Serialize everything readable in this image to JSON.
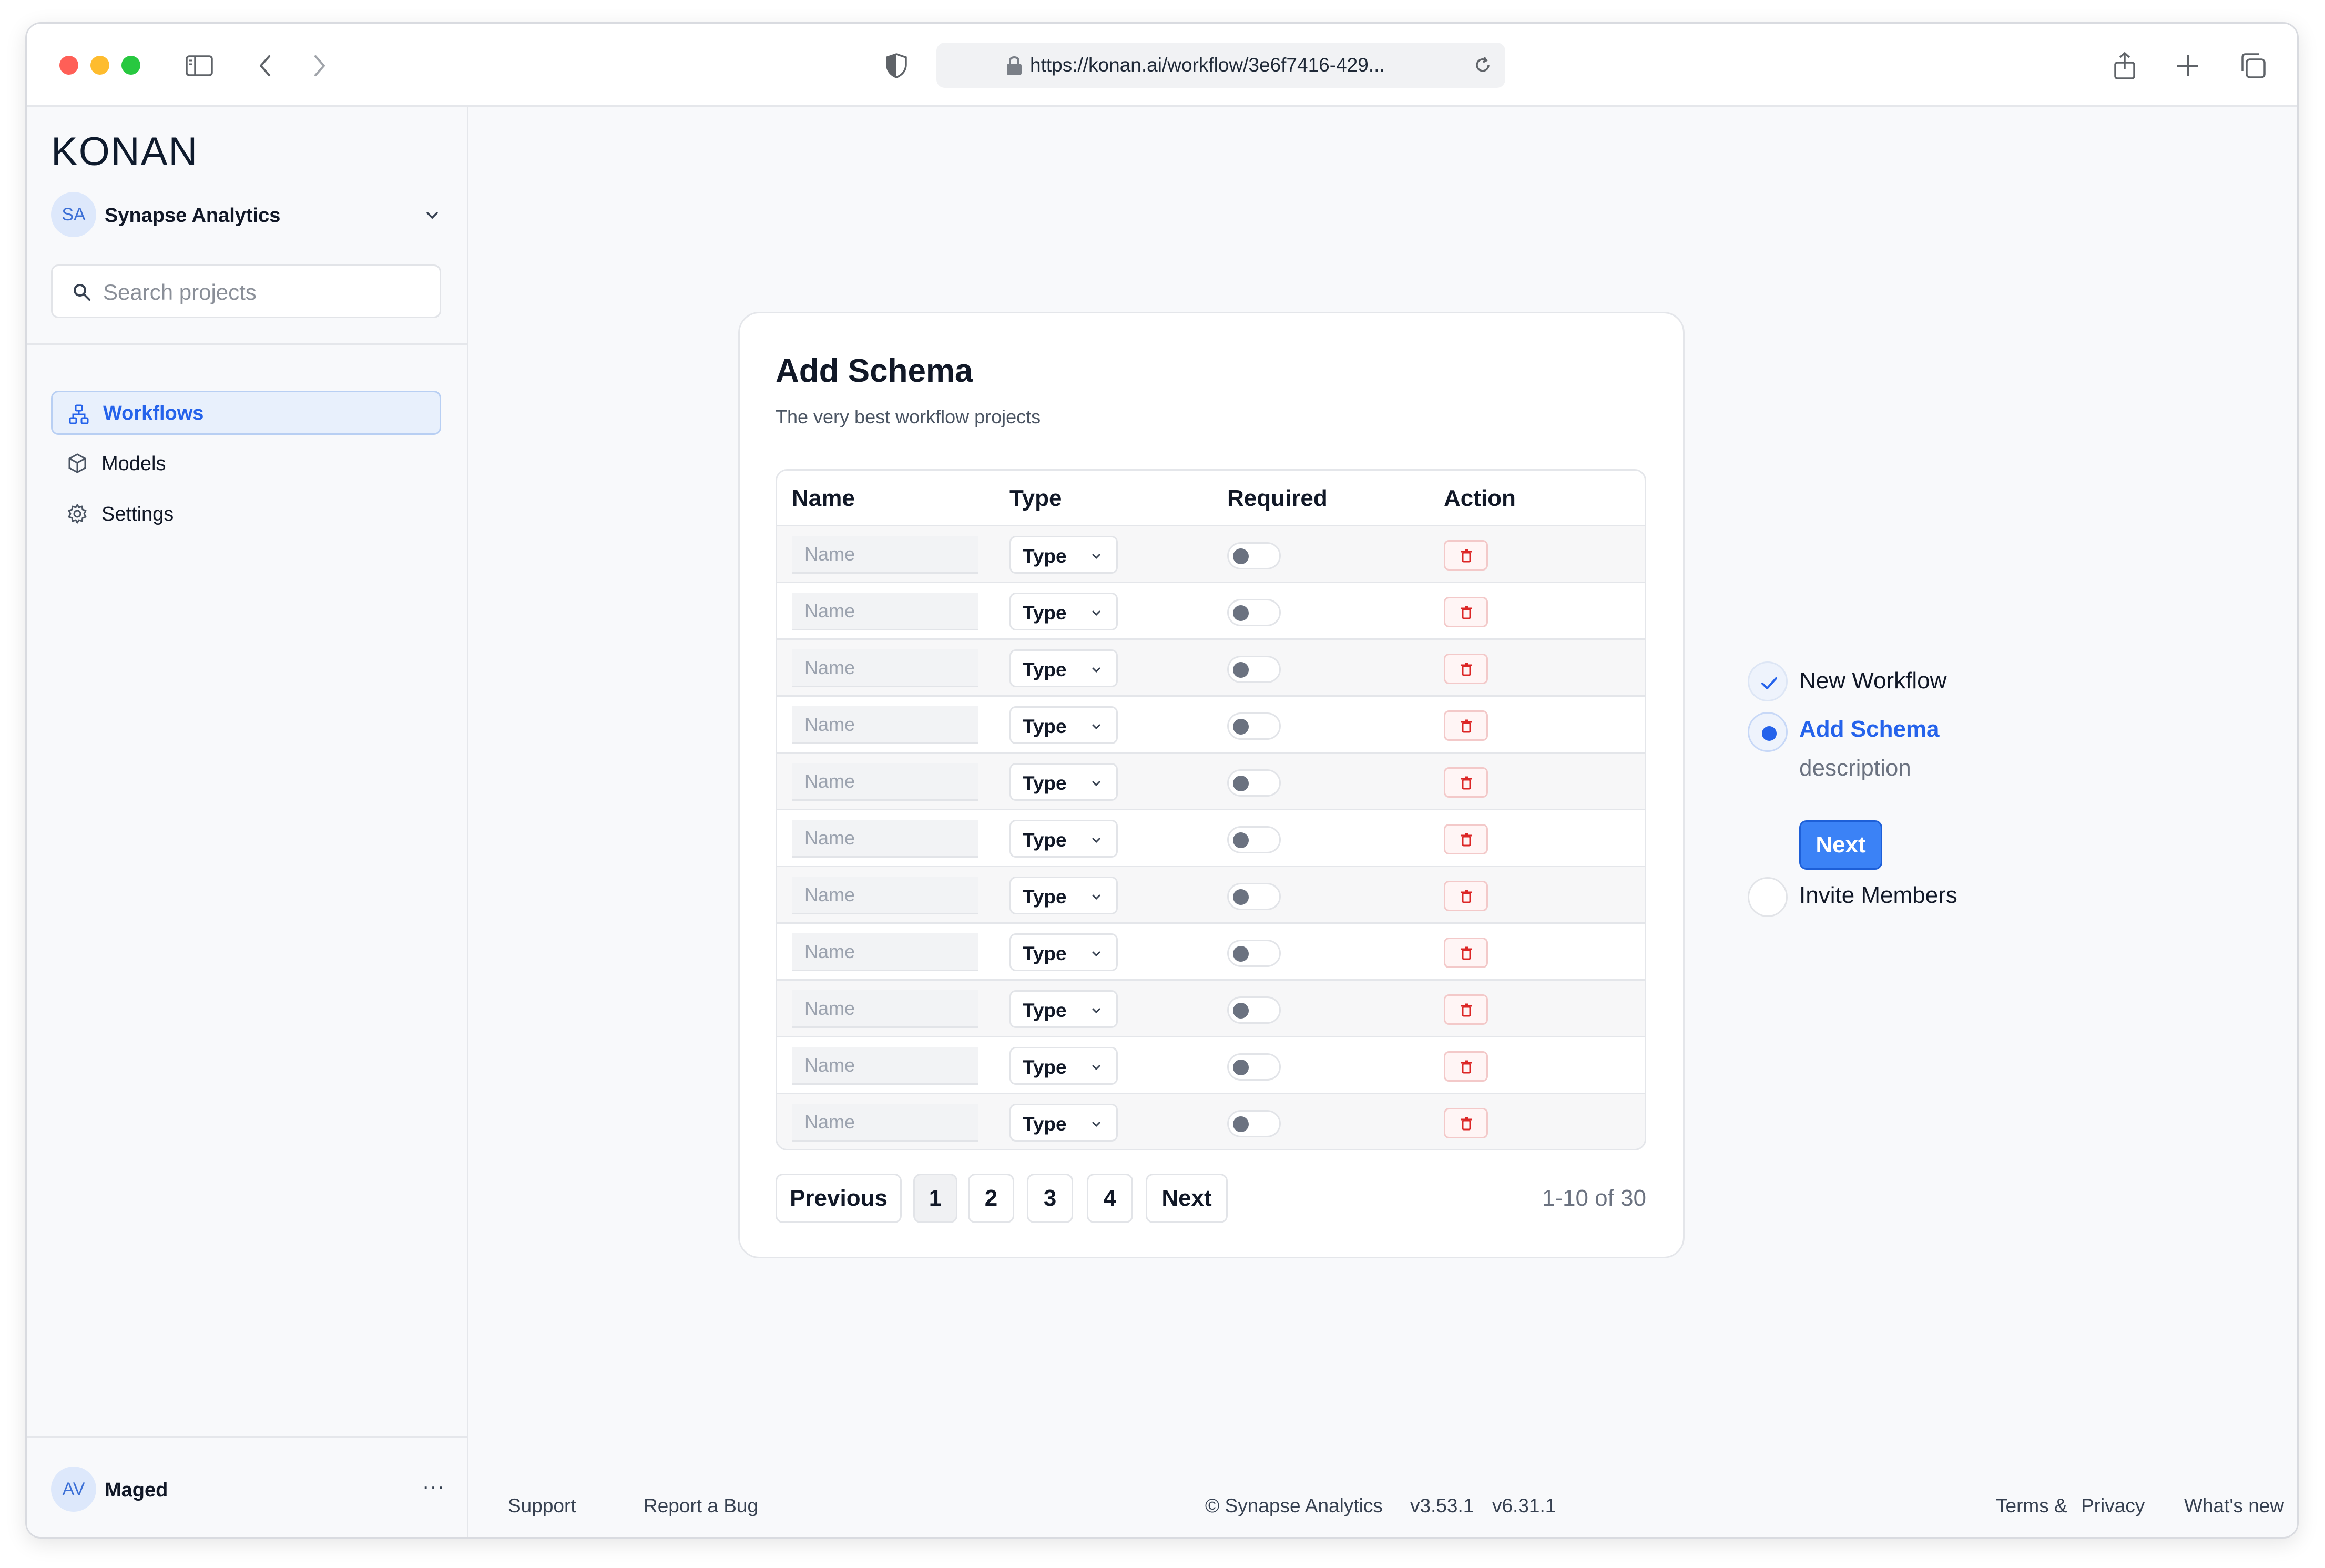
{
  "browser": {
    "url": "https://konan.ai/workflow/3e6f7416-429..."
  },
  "sidebar": {
    "logo": "KONAN",
    "org": {
      "initials": "SA",
      "name": "Synapse Analytics"
    },
    "search_placeholder": "Search projects",
    "nav": [
      {
        "label": "Workflows",
        "icon": "workflow-icon",
        "active": true
      },
      {
        "label": "Models",
        "icon": "cube-icon",
        "active": false
      },
      {
        "label": "Settings",
        "icon": "gear-icon",
        "active": false
      }
    ],
    "user": {
      "initials": "AV",
      "name": "Maged",
      "menu": "···"
    }
  },
  "card": {
    "title": "Add Schema",
    "subtitle": "The very best workflow projects",
    "columns": [
      "Name",
      "Type",
      "Required",
      "Action"
    ],
    "rows": [
      {
        "name_placeholder": "Name",
        "type": "Type",
        "required": false
      },
      {
        "name_placeholder": "Name",
        "type": "Type",
        "required": false
      },
      {
        "name_placeholder": "Name",
        "type": "Type",
        "required": false
      },
      {
        "name_placeholder": "Name",
        "type": "Type",
        "required": false
      },
      {
        "name_placeholder": "Name",
        "type": "Type",
        "required": false
      },
      {
        "name_placeholder": "Name",
        "type": "Type",
        "required": false
      },
      {
        "name_placeholder": "Name",
        "type": "Type",
        "required": false
      },
      {
        "name_placeholder": "Name",
        "type": "Type",
        "required": false
      },
      {
        "name_placeholder": "Name",
        "type": "Type",
        "required": false
      },
      {
        "name_placeholder": "Name",
        "type": "Type",
        "required": false
      },
      {
        "name_placeholder": "Name",
        "type": "Type",
        "required": false
      }
    ],
    "pagination": {
      "previous": "Previous",
      "pages": [
        "1",
        "2",
        "3",
        "4"
      ],
      "current_page": "1",
      "next": "Next",
      "count": "1-10 of 30"
    }
  },
  "steps": [
    {
      "label": "New Workflow",
      "state": "done"
    },
    {
      "label": "Add Schema",
      "state": "current",
      "description": "description",
      "button": "Next"
    },
    {
      "label": "Invite Members",
      "state": "upcoming"
    }
  ],
  "footer": {
    "support": "Support",
    "report_bug": "Report a Bug",
    "copyright": "© Synapse Analytics",
    "version_a": "v3.53.1",
    "version_b": "v6.31.1",
    "terms": "Terms &",
    "privacy": "Privacy",
    "whats_new": "What's new"
  },
  "colors": {
    "accent": "#2563eb",
    "danger": "#dc2626",
    "background": "#f8f9fb"
  }
}
